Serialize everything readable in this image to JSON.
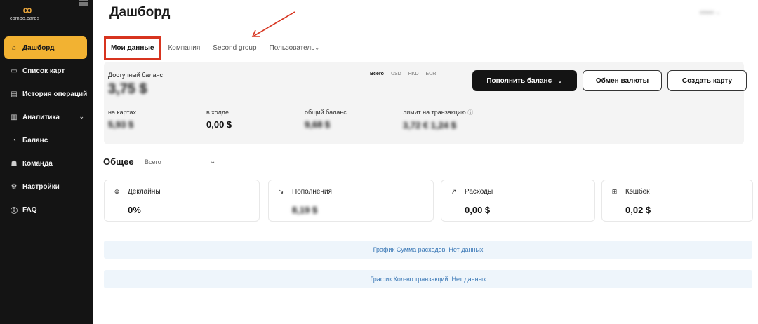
{
  "brand": {
    "name": "combo.cards",
    "logo_icon": "infinity-logo-icon"
  },
  "sidebar": {
    "items": [
      {
        "label": "Дашборд",
        "icon": "home-icon",
        "active": true
      },
      {
        "label": "Список карт",
        "icon": "cards-icon"
      },
      {
        "label": "История операций",
        "icon": "history-icon"
      },
      {
        "label": "Аналитика",
        "icon": "chart-icon",
        "has_submenu": true
      },
      {
        "label": "Баланс",
        "icon": "wallet-icon"
      },
      {
        "label": "Команда",
        "icon": "team-icon"
      },
      {
        "label": "Настройки",
        "icon": "gear-icon"
      },
      {
        "label": "FAQ",
        "icon": "info-icon"
      }
    ],
    "accent": "#f2b232",
    "background": "#141414"
  },
  "header": {
    "title": "Дашборд",
    "user": "кекин"
  },
  "tabs": [
    {
      "label": "Мои данные",
      "active": true
    },
    {
      "label": "Компания"
    },
    {
      "label": "Second group"
    },
    {
      "label": "Пользователь",
      "dropdown": true
    }
  ],
  "balance": {
    "label": "Доступный баланс",
    "value": "3,75 $",
    "currencies": [
      {
        "label": "Всего",
        "selected": true
      },
      {
        "label": "USD"
      },
      {
        "label": "HKD"
      },
      {
        "label": "EUR"
      }
    ],
    "buttons": {
      "top_up": "Пополнить баланс",
      "exchange": "Обмен валюты",
      "create_card": "Создать карту"
    },
    "stats": [
      {
        "label": "на картах",
        "value": "5,93 $"
      },
      {
        "label": "в холде",
        "value": "0,00 $"
      },
      {
        "label": "общий баланс",
        "value": "9,68 $"
      },
      {
        "label": "лимит на транзакцию",
        "value": "3,72 €   1,24 $",
        "info": true
      }
    ]
  },
  "general": {
    "title": "Общее",
    "filter": "Всего",
    "cards": [
      {
        "label": "Деклайны",
        "value": "0%",
        "icon": "decline-icon"
      },
      {
        "label": "Пополнения",
        "value": "8,19 $",
        "icon": "arrow-down-right-icon"
      },
      {
        "label": "Расходы",
        "value": "0,00 $",
        "icon": "arrow-up-right-icon"
      },
      {
        "label": "Кэшбек",
        "value": "0,02 $",
        "icon": "gift-icon"
      }
    ]
  },
  "charts": [
    {
      "label": "График Сумма расходов. Нет данных"
    },
    {
      "label": "График Кол-во транзакций. Нет данных"
    }
  ],
  "annotation": {
    "highlight_color": "#d7341f"
  }
}
